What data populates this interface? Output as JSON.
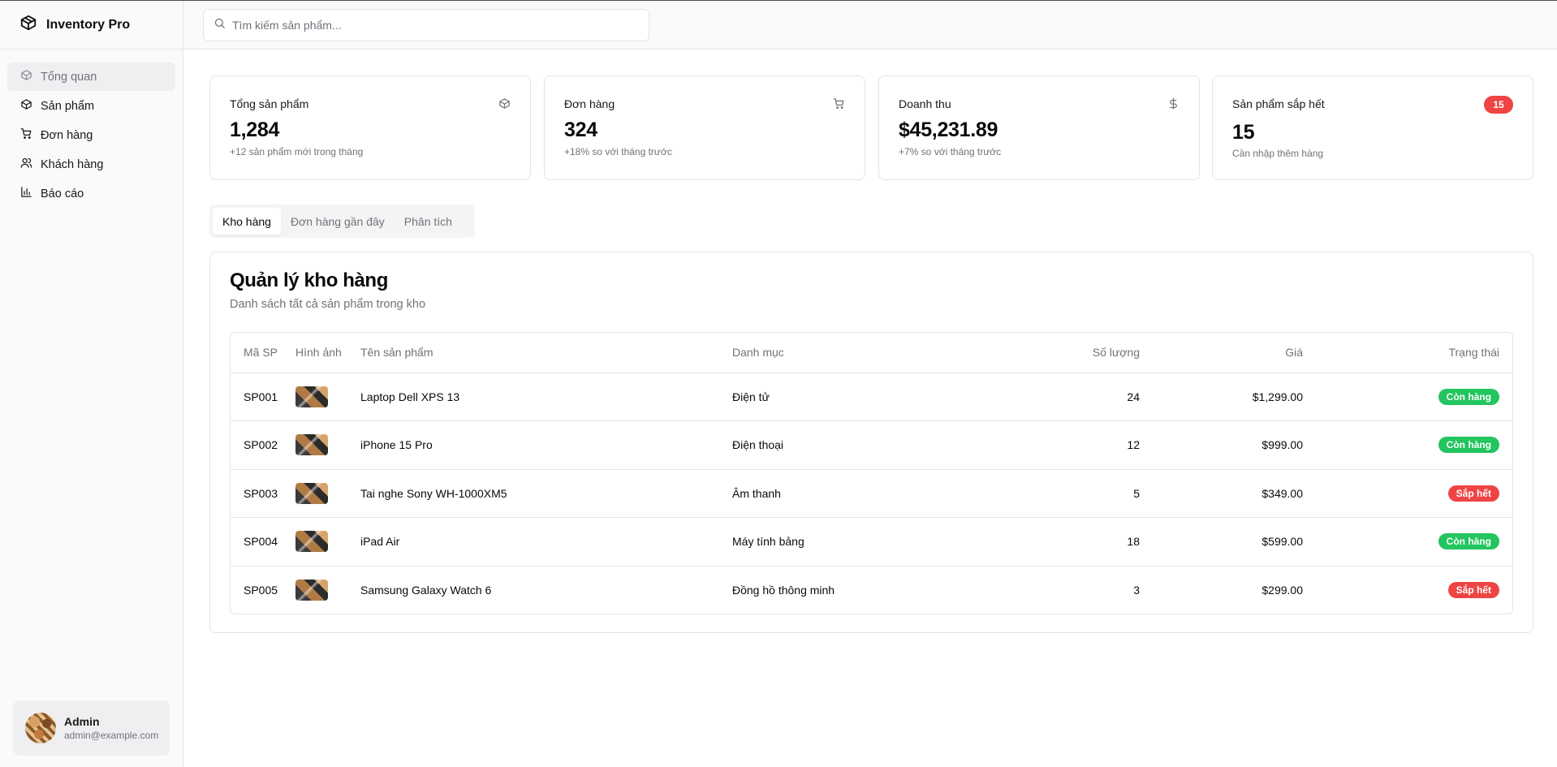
{
  "app": {
    "title": "Inventory Pro"
  },
  "search": {
    "placeholder": "Tìm kiếm sản phẩm..."
  },
  "sidebar": {
    "items": [
      {
        "label": "Tổng quan",
        "icon": "package-icon"
      },
      {
        "label": "Sản phẩm",
        "icon": "package-icon"
      },
      {
        "label": "Đơn hàng",
        "icon": "cart-icon"
      },
      {
        "label": "Khách hàng",
        "icon": "users-icon"
      },
      {
        "label": "Báo cáo",
        "icon": "bar-chart-icon"
      }
    ],
    "active_index": 0
  },
  "user": {
    "name": "Admin",
    "email": "admin@example.com"
  },
  "stats": [
    {
      "title": "Tổng sản phẩm",
      "value": "1,284",
      "sub": "+12 sản phẩm mới trong tháng",
      "icon": "package-icon"
    },
    {
      "title": "Đơn hàng",
      "value": "324",
      "sub": "+18% so với tháng trước",
      "icon": "cart-icon"
    },
    {
      "title": "Doanh thu",
      "value": "$45,231.89",
      "sub": "+7% so với tháng trước",
      "icon": "dollar-icon"
    },
    {
      "title": "Sản phẩm sắp hết",
      "value": "15",
      "sub": "Cần nhập thêm hàng",
      "badge": "15"
    }
  ],
  "tabs": [
    {
      "label": "Kho hàng"
    },
    {
      "label": "Đơn hàng gần đây"
    },
    {
      "label": "Phân tích"
    }
  ],
  "active_tab": 0,
  "inventory": {
    "title": "Quản lý kho hàng",
    "description": "Danh sách tất cả sản phẩm trong kho",
    "columns": [
      "Mã SP",
      "Hình ảnh",
      "Tên sản phẩm",
      "Danh mục",
      "Số lượng",
      "Giá",
      "Trạng thái"
    ],
    "rows": [
      {
        "code": "SP001",
        "name": "Laptop Dell XPS 13",
        "category": "Điện tử",
        "qty": "24",
        "price": "$1,299.00",
        "status": "Còn hàng"
      },
      {
        "code": "SP002",
        "name": "iPhone 15 Pro",
        "category": "Điện thoại",
        "qty": "12",
        "price": "$999.00",
        "status": "Còn hàng"
      },
      {
        "code": "SP003",
        "name": "Tai nghe Sony WH-1000XM5",
        "category": "Âm thanh",
        "qty": "5",
        "price": "$349.00",
        "status": "Sắp hết"
      },
      {
        "code": "SP004",
        "name": "iPad Air",
        "category": "Máy tính bảng",
        "qty": "18",
        "price": "$599.00",
        "status": "Còn hàng"
      },
      {
        "code": "SP005",
        "name": "Samsung Galaxy Watch 6",
        "category": "Đồng hồ thông minh",
        "qty": "3",
        "price": "$299.00",
        "status": "Sắp hết"
      }
    ]
  },
  "colors": {
    "in_stock": "#22c55e",
    "low_stock": "#ef4444",
    "badge": "#ef4444"
  }
}
